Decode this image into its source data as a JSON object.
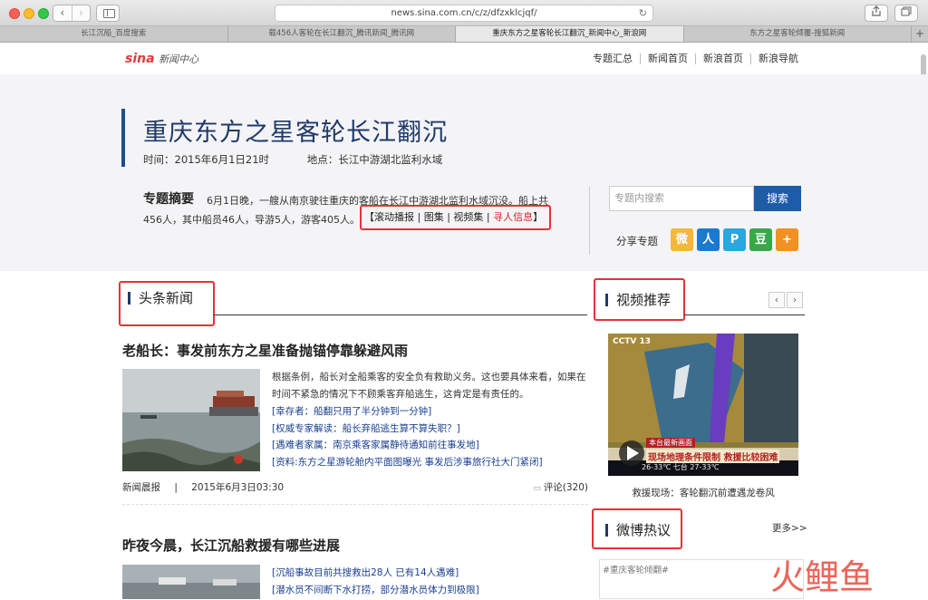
{
  "browser": {
    "url": "news.sina.com.cn/c/z/dfzxklcjqf/",
    "tabs": [
      {
        "label": "长江沉船_百度搜索"
      },
      {
        "label": "载456人客轮在长江翻沉_腾讯新闻_腾讯网"
      },
      {
        "label": "重庆东方之星客轮长江翻沉_新闻中心_新浪网"
      },
      {
        "label": "东方之星客轮倾覆-搜狐新闻"
      }
    ],
    "active_tab": 2,
    "back": "‹",
    "forward": "›",
    "reload": "↻",
    "new_tab": "+"
  },
  "header": {
    "logo_brand": "sina",
    "logo_sub": "新闻中心",
    "nav": [
      "专题汇总",
      "新闻首页",
      "新浪首页",
      "新浪导航"
    ]
  },
  "hero": {
    "title": "重庆东方之星客轮长江翻沉",
    "time": "时间：2015年6月1日21时",
    "location": "地点：长江中游湖北监利水域",
    "summary_label": "专题摘要",
    "summary_text": "6月1日晚，一艘从南京驶往重庆的客船在长江中游湖北监利水域沉没。船上共456人，其中船员46人，导游5人，游客405人。",
    "summary_links": {
      "open": "【",
      "items": [
        "滚动播报",
        "图集",
        "视频集"
      ],
      "highlight": "寻人信息",
      "close": "】"
    },
    "search_placeholder": "专题内搜索",
    "search_button": "搜索",
    "share_label": "分享专题"
  },
  "share_icons": [
    {
      "name": "weibo-icon",
      "glyph": "微",
      "color": "#f4b73c"
    },
    {
      "name": "renren-icon",
      "glyph": "人",
      "color": "#1a7ad1"
    },
    {
      "name": "qzone-icon",
      "glyph": "P",
      "color": "#2aa6e0"
    },
    {
      "name": "douban-icon",
      "glyph": "豆",
      "color": "#39a84a"
    },
    {
      "name": "more-share-icon",
      "glyph": "+",
      "color": "#f19023"
    }
  ],
  "headlines": {
    "section_title": "头条新闻",
    "articles": [
      {
        "title": "老船长：事发前东方之星准备抛锚停靠躲避风雨",
        "body": "根据条例，船长对全船乘客的安全负有救助义务。这也要具体来看，如果在时间不紧急的情况下不顾乘客弃船逃生，这肯定是有责任的。",
        "links": [
          "[幸存者：船翻只用了半分钟到一分钟]",
          "[权威专家解读：船长弃船逃生算不算失职？]",
          "[遇难者家属：南京乘客家属静待通知前往事发地]",
          "[资料:东方之星游轮舱内平面图曝光 事发后涉事旅行社大门紧闭]"
        ],
        "source": "新闻晨报",
        "separator": "|",
        "date": "2015年6月3日03:30",
        "comments": "评论(320)"
      },
      {
        "title": "昨夜今晨，长江沉船救援有哪些进展",
        "links": [
          "[沉船事故目前共搜救出28人 已有14人遇难]",
          "[潜水员不间断下水打捞，部分潜水员体力到极限]"
        ]
      }
    ]
  },
  "video": {
    "section_title": "视频推荐",
    "prev": "‹",
    "next": "›",
    "channel": "CCTV 13",
    "ticker_top": "本台最新画面",
    "ticker_main": "现场地理条件限制 救援比较困难",
    "weather": "26-33℃ 七台 27-33℃",
    "caption": "救援现场：客轮翻沉前遭遇龙卷风"
  },
  "weibo": {
    "section_title": "微博热议",
    "more": "更多>>",
    "input_placeholder": "#重庆客轮倾翻#"
  },
  "watermark": {
    "text": "火鲤鱼"
  }
}
